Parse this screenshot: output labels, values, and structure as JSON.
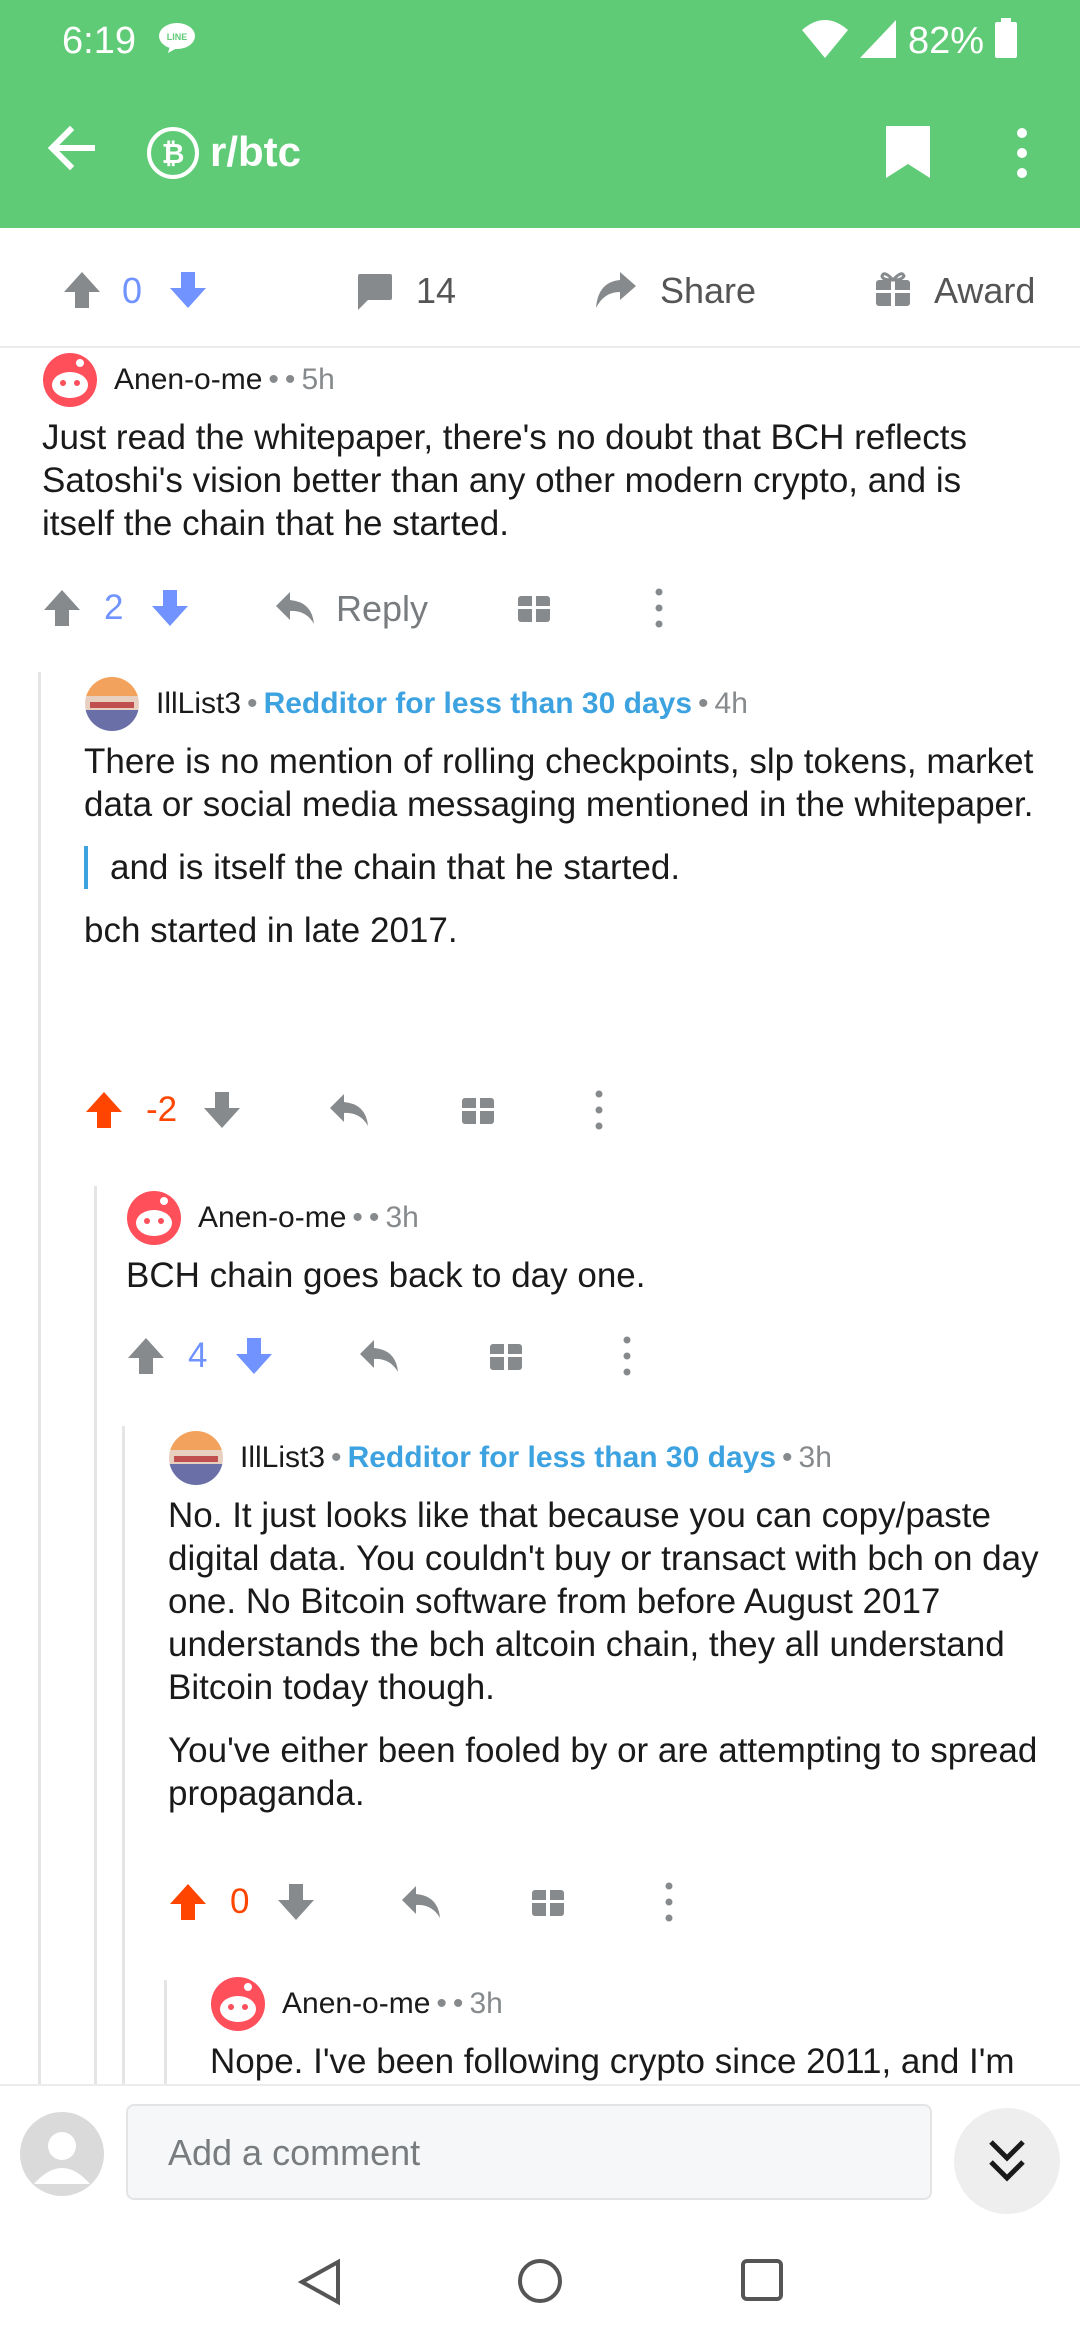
{
  "status_bar": {
    "time": "6:19",
    "battery": "82%",
    "notification_icon": "line-app-icon"
  },
  "app_bar": {
    "subreddit": "r/btc",
    "back_icon": "arrow-left-icon",
    "bookmark_icon": "bookmark-icon",
    "more_icon": "more-vertical-icon"
  },
  "post_actions": {
    "score": "0",
    "comment_count": "14",
    "share_label": "Share",
    "award_label": "Award"
  },
  "comments": [
    {
      "author": "Anen-o-me",
      "time": "5h",
      "flair": "",
      "body": [
        "Just read the whitepaper, there's no doubt that BCH reflects Satoshi's vision better than any other modern crypto, and is itself the chain that he started."
      ],
      "score": "2",
      "vote": "none",
      "reply_label": "Reply"
    },
    {
      "author": "IllList3",
      "time": "4h",
      "flair": "Redditor for less than 30 days",
      "body_1": "There is no mention of rolling checkpoints, slp tokens, market data or social media messaging mentioned in the whitepaper.",
      "quote": "and is itself the chain that he started.",
      "body_2": "bch started in late 2017.",
      "score": "-2",
      "vote": "up"
    },
    {
      "author": "Anen-o-me",
      "time": "3h",
      "flair": "",
      "body": "BCH chain goes back to day one.",
      "score": "4",
      "vote": "none"
    },
    {
      "author": "IllList3",
      "time": "3h",
      "flair": "Redditor for less than 30 days",
      "body_1": "No.  It just looks like that because you can copy/paste digital data.  You couldn't buy or transact with bch on day one.  No Bitcoin software from before August 2017 understands the bch altcoin chain, they all understand Bitcoin today though.",
      "body_2": "You've either been fooled by or are attempting to spread propaganda.",
      "score": "0",
      "vote": "up"
    },
    {
      "author": "Anen-o-me",
      "time": "3h",
      "flair": "",
      "body": "Nope. I've been following crypto since 2011, and I'm"
    }
  ],
  "composer": {
    "placeholder": "Add a comment",
    "jump_icon": "double-chevron-down-icon"
  },
  "colors": {
    "app_bar": "#5fcb76",
    "upvote": "#ff4500",
    "downvote": "#7193ff",
    "flair": "#3da2e0",
    "quote_bar": "#3da2e0"
  }
}
